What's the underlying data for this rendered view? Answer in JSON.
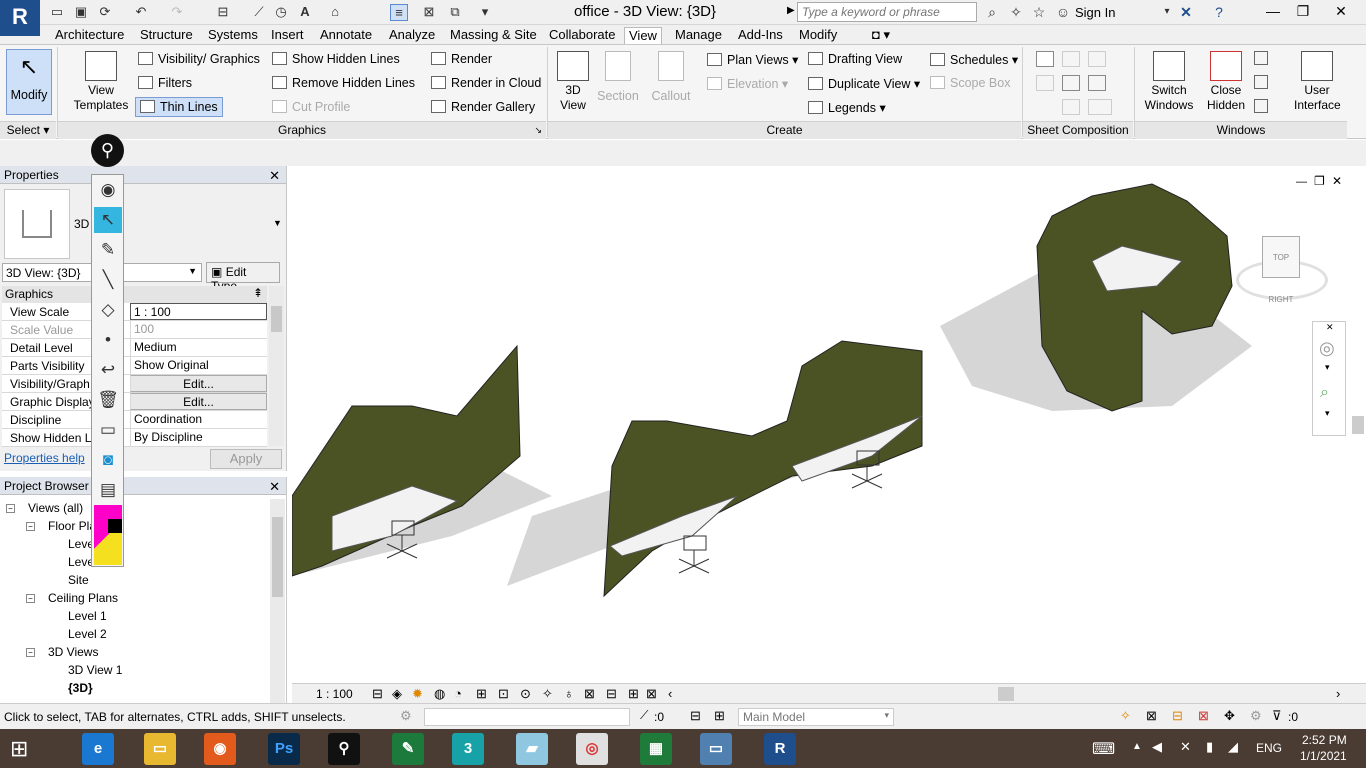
{
  "app": {
    "title": "office - 3D View: {3D}",
    "logo": "R",
    "search_placeholder": "Type a keyword or phrase",
    "sign_in": "Sign In"
  },
  "ribbon": {
    "tabs": [
      "Architecture",
      "Structure",
      "Systems",
      "Insert",
      "Annotate",
      "Analyze",
      "Massing & Site",
      "Collaborate",
      "View",
      "Manage",
      "Add-Ins",
      "Modify"
    ],
    "active_tab": "View",
    "modify": "Modify",
    "select": "Select",
    "view_templates": "View Templates",
    "visibility_graphics": "Visibility/ Graphics",
    "filters": "Filters",
    "thin_lines": "Thin Lines",
    "show_hidden_lines": "Show Hidden Lines",
    "remove_hidden_lines": "Remove Hidden Lines",
    "cut_profile": "Cut Profile",
    "render": "Render",
    "render_cloud": "Render in Cloud",
    "render_gallery": "Render Gallery",
    "graphics_panel": "Graphics",
    "view_3d": "3D View",
    "section": "Section",
    "callout": "Callout",
    "plan_views": "Plan Views",
    "elevation": "Elevation",
    "drafting_view": "Drafting View",
    "duplicate_view": "Duplicate View",
    "legends": "Legends",
    "schedules": "Schedules",
    "scope_box": "Scope Box",
    "create_panel": "Create",
    "sheet_composition_panel": "Sheet Composition",
    "switch_windows": "Switch Windows",
    "close_hidden": "Close Hidden",
    "user_interface": "User Interface",
    "windows_panel": "Windows"
  },
  "properties": {
    "title": "Properties",
    "type_label": "3D",
    "view_selector": "3D View: {3D}",
    "edit_type": "Edit Type",
    "group": "Graphics",
    "rows": [
      {
        "k": "View Scale",
        "v": "1 : 100"
      },
      {
        "k": "Scale Value",
        "v": "100"
      },
      {
        "k": "Detail Level",
        "v": "Medium"
      },
      {
        "k": "Parts Visibility",
        "v": "Show Original"
      },
      {
        "k": "Visibility/Graph",
        "v": "Edit..."
      },
      {
        "k": "Graphic Display",
        "v": "Edit..."
      },
      {
        "k": "Discipline",
        "v": "Coordination"
      },
      {
        "k": "Show Hidden L",
        "v": "By Discipline"
      }
    ],
    "help": "Properties help",
    "apply": "Apply"
  },
  "browser": {
    "title": "Project Browser",
    "root": "Views (all)",
    "floor_plans": "Floor Plans",
    "fp_level1": "Level 1",
    "fp_level2": "Level 2",
    "fp_site": "Site",
    "ceiling_plans": "Ceiling Plans",
    "cp_level1": "Level 1",
    "cp_level2": "Level 2",
    "views_3d": "3D Views",
    "v3d_1": "3D View 1",
    "v3d_current": "{3D}"
  },
  "viewport": {
    "scale": "1 : 100",
    "viewcube": "TOP RIGHT"
  },
  "status": {
    "hint": "Click to select, TAB for alternates, CTRL adds, SHIFT unselects.",
    "zero1": ":0",
    "model": "Main Model",
    "zero2": ":0"
  },
  "taskbar": {
    "lang": "ENG",
    "time": "2:52 PM",
    "date": "1/1/2021"
  },
  "colors": {
    "accent": "#1f4e8c",
    "partition": "#4b5324",
    "taskbar": "#4a3b33"
  }
}
